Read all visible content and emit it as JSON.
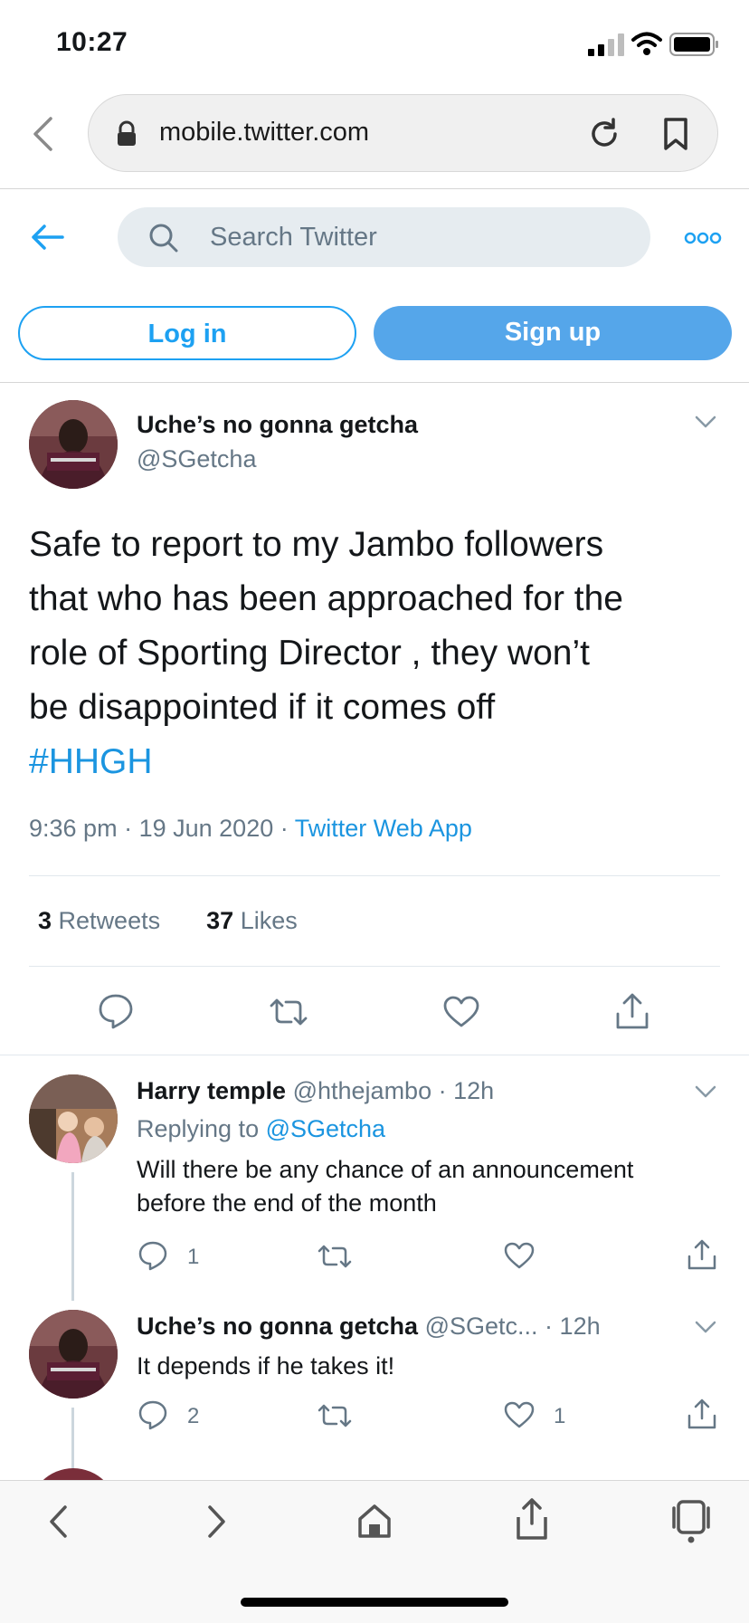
{
  "status_bar": {
    "time": "10:27"
  },
  "browser": {
    "url": "mobile.twitter.com"
  },
  "header": {
    "search_placeholder": "Search Twitter",
    "login_label": "Log in",
    "signup_label": "Sign up"
  },
  "tweet": {
    "display_name": "Uche’s no gonna getcha",
    "handle": "@SGetcha",
    "text_lines": [
      "Safe to report to my Jambo followers",
      "that who has been approached for the",
      "role of Sporting Director , they won’t",
      "be disappointed if it comes off"
    ],
    "hashtag": "#HHGH",
    "time": "9:36 pm",
    "date": "19 Jun 2020",
    "source": "Twitter Web App",
    "retweets_count": "3",
    "retweets_label": "Retweets",
    "likes_count": "37",
    "likes_label": "Likes"
  },
  "replies": [
    {
      "display_name": "Harry temple",
      "handle": "@hthejambo",
      "age": "12h",
      "replying_to_label": "Replying to",
      "replying_to_handle": "@SGetcha",
      "text_lines": [
        "Will there be any chance of an announcement",
        "before the end of the month"
      ],
      "reply_count": "1",
      "like_count": ""
    },
    {
      "display_name": "Uche’s no gonna getcha",
      "handle": "@SGetc...",
      "age": "12h",
      "text_lines": [
        "It depends if he takes it!"
      ],
      "reply_count": "2",
      "like_count": "1"
    }
  ],
  "sep": "·",
  "colors": {
    "twitter_blue": "#1da1f2",
    "link_blue": "#1b95e0",
    "muted": "#657786"
  }
}
